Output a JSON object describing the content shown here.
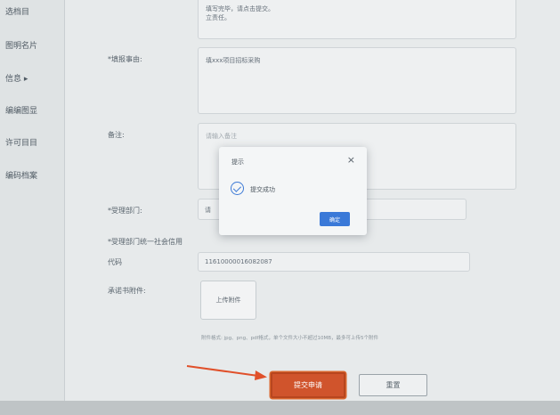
{
  "sidebar": {
    "items": [
      {
        "label": "选档目"
      },
      {
        "label": "图明名片"
      },
      {
        "label": "信息 ▸"
      },
      {
        "label": "编编图显"
      },
      {
        "label": "许可目目"
      },
      {
        "label": "编码档案"
      }
    ]
  },
  "form": {
    "top_text_fragment": "填写完毕，请点击提交。",
    "top_text_fragment2": "立责任。",
    "matter_label": "*填报事由:",
    "matter_value": "填xxx项目招标采购",
    "remark_label": "备注:",
    "remark_placeholder": "请输入备注",
    "dept_label": "*受理部门:",
    "dept_value": "请",
    "credit_label_line1": "*受理部门统一社会信用",
    "credit_label_line2": "代码",
    "credit_value": "11610000016082087",
    "attachment_label": "承诺书附件:",
    "upload_label": "上传附件",
    "hint": "附件格式: jpg、png、pdf格式，单个文件大小不超过10MB，最多可上传5个附件"
  },
  "dialog": {
    "title": "提示",
    "close_glyph": "×",
    "message": "提交成功",
    "ok_label": "确定"
  },
  "actions": {
    "submit_label": "提交申请",
    "reset_label": "重置"
  },
  "colors": {
    "accent_blue": "#3a79d8",
    "submit_orange": "#d0542c",
    "arrow_red": "#e0502a"
  },
  "icons": {
    "check": "check-circle-icon",
    "close": "close-icon",
    "arrow": "arrow-right-icon"
  }
}
